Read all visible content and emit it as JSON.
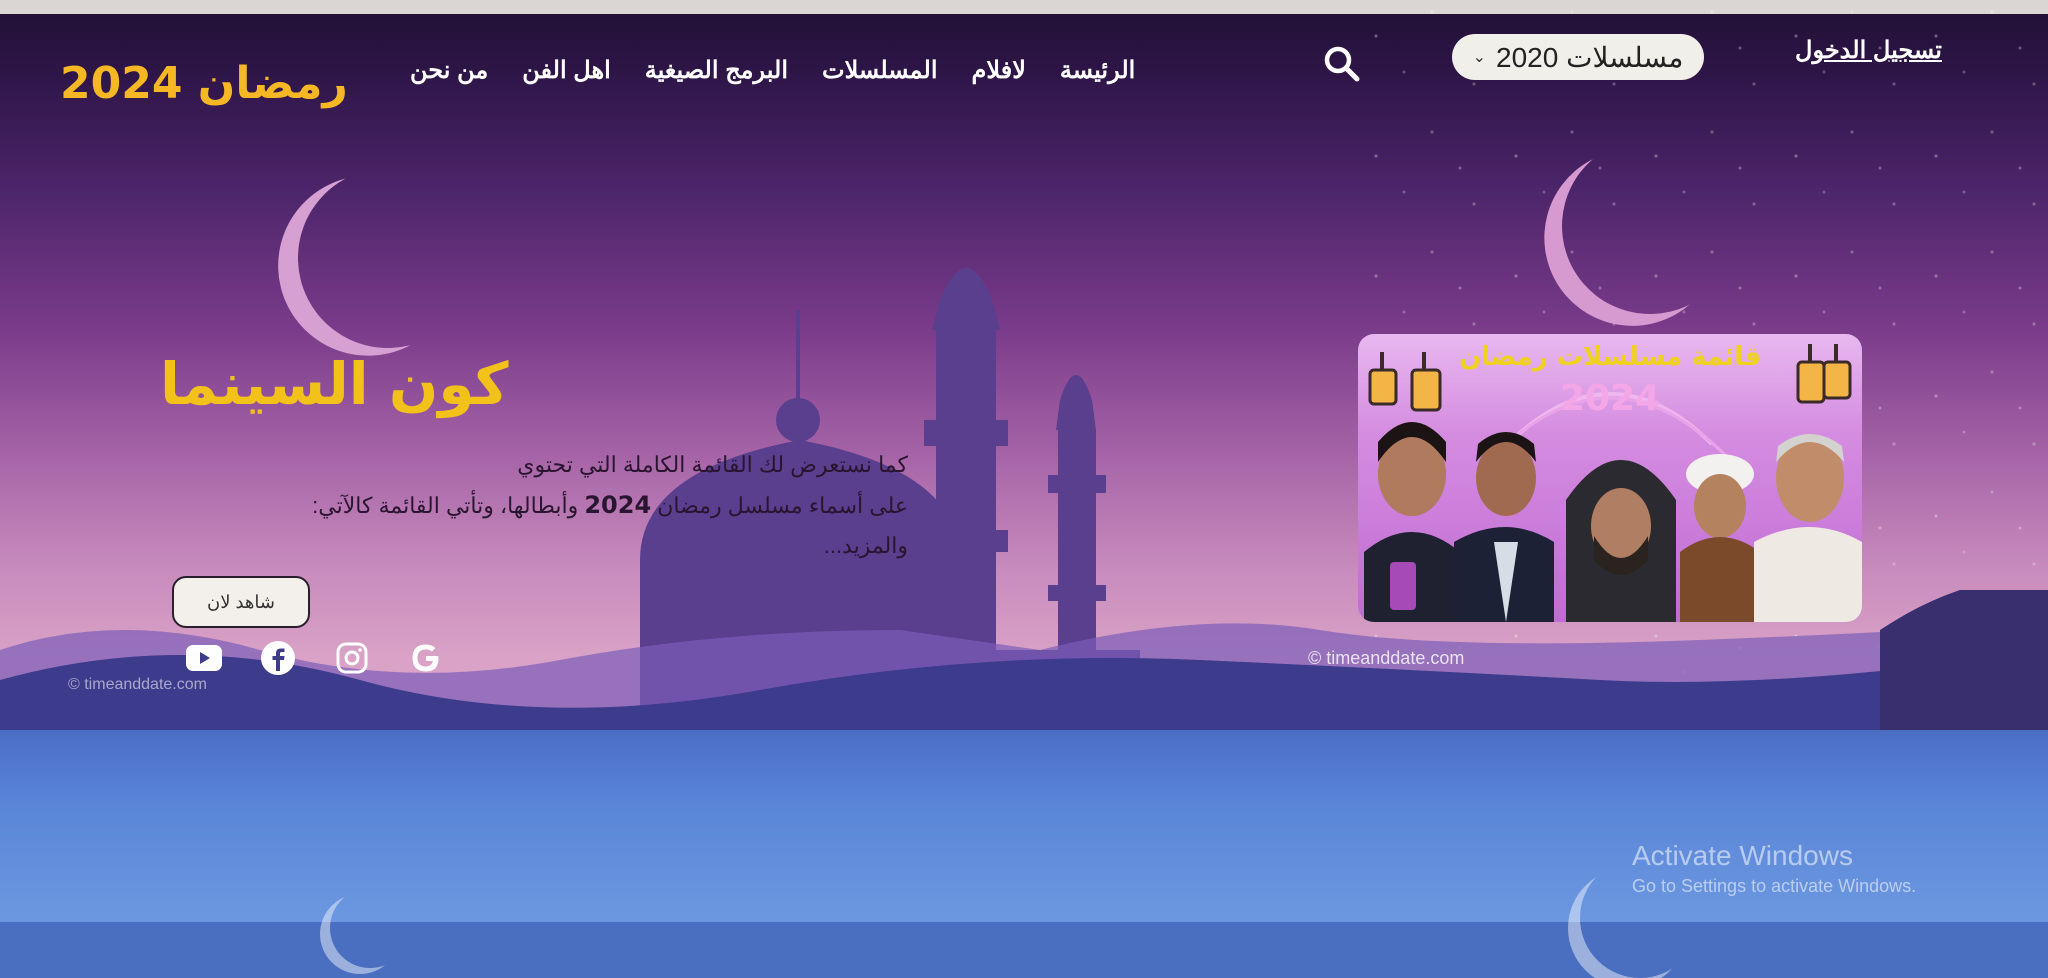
{
  "header": {
    "brand": "رمضان 2024",
    "nav": [
      "الرئيسة",
      "لافلام",
      "المسلسلات",
      "البرمج الصيغية",
      "اهل الفن",
      "من نحن"
    ],
    "select": {
      "value": "مسلسلات 2020"
    },
    "login": "تسجيل الدخول"
  },
  "hero": {
    "title": "كون السينما",
    "desc_line1": "كما نستعرض لك القائمة الكاملة التي تحتوي",
    "desc_line2_pre": "على أسماء مسلسل رمضان ",
    "desc_year": "2024",
    "desc_line2_post": " وأبطالها، وتأتي القائمة كالآتي:",
    "desc_line3": "والمزيد...",
    "watch_button": "شاهد لان",
    "socials": [
      "youtube-icon",
      "facebook-icon",
      "instagram-icon",
      "google-icon"
    ]
  },
  "poster": {
    "title": "قائمة مسلسلات رمضان",
    "year": "2024"
  },
  "watermark": "© timeanddate.com",
  "os_notice": {
    "line1": "Activate Windows",
    "line2": "Go to Settings to activate Windows."
  },
  "colors": {
    "brand": "#f5b824",
    "title": "#f3c21a",
    "purple": "#7a3b8a",
    "navy": "#2e2e78",
    "lower_blue": "#5a86d8"
  }
}
